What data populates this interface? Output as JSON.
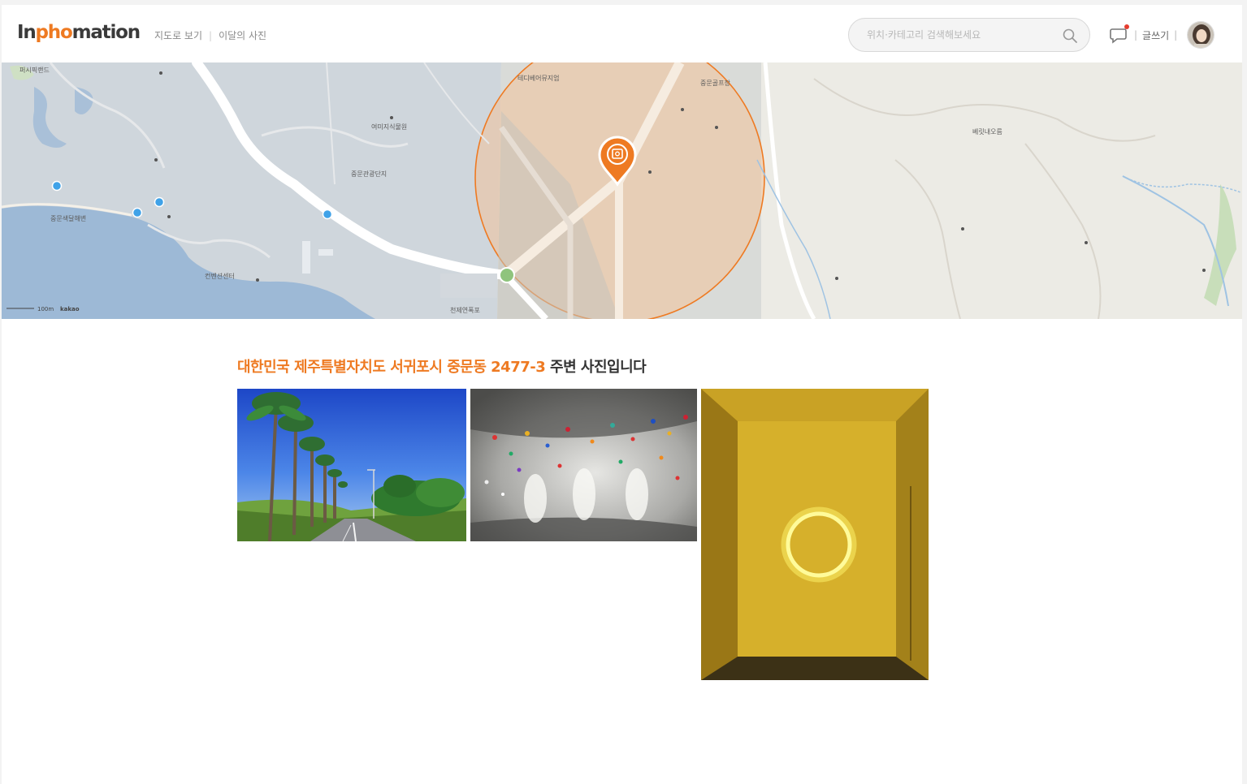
{
  "header": {
    "logo_prefix": "In",
    "logo_accent": "pho",
    "logo_suffix": "mation",
    "nav": [
      "지도로 보기",
      "이달의 사진"
    ],
    "search_placeholder": "위치·카테고리 검색해보세요",
    "write_label": "글쓰기",
    "icons": [
      "search-icon",
      "chat-icon",
      "avatar"
    ]
  },
  "map": {
    "scale_label": "100m",
    "provider": "kakao",
    "labels": [
      "퍼시픽랜드",
      "중문색달해변",
      "컨벤션센터",
      "중문관광단지",
      "여미지식물원",
      "테디베어뮤지엄",
      "천제연폭포",
      "중문골프장",
      "베릿내오름"
    ],
    "marker_icon": "photo-pin-icon"
  },
  "content": {
    "headline_address": "대한민국 제주특별자치도 서귀포시 중문동 2477-3",
    "headline_suffix": " 주변 사진입니다",
    "photos": [
      {
        "name": "palm-road-photo",
        "desc": "palm trees road"
      },
      {
        "name": "gallery-wall-photo",
        "desc": "gallery wall"
      },
      {
        "name": "neon-ring-photo",
        "desc": "yellow neon ring room"
      }
    ]
  },
  "colors": {
    "accent": "#ee7a22",
    "map_sea": "#a8c4e0",
    "map_land": "#eeede8",
    "circle_fill": "#f5c9a0"
  }
}
